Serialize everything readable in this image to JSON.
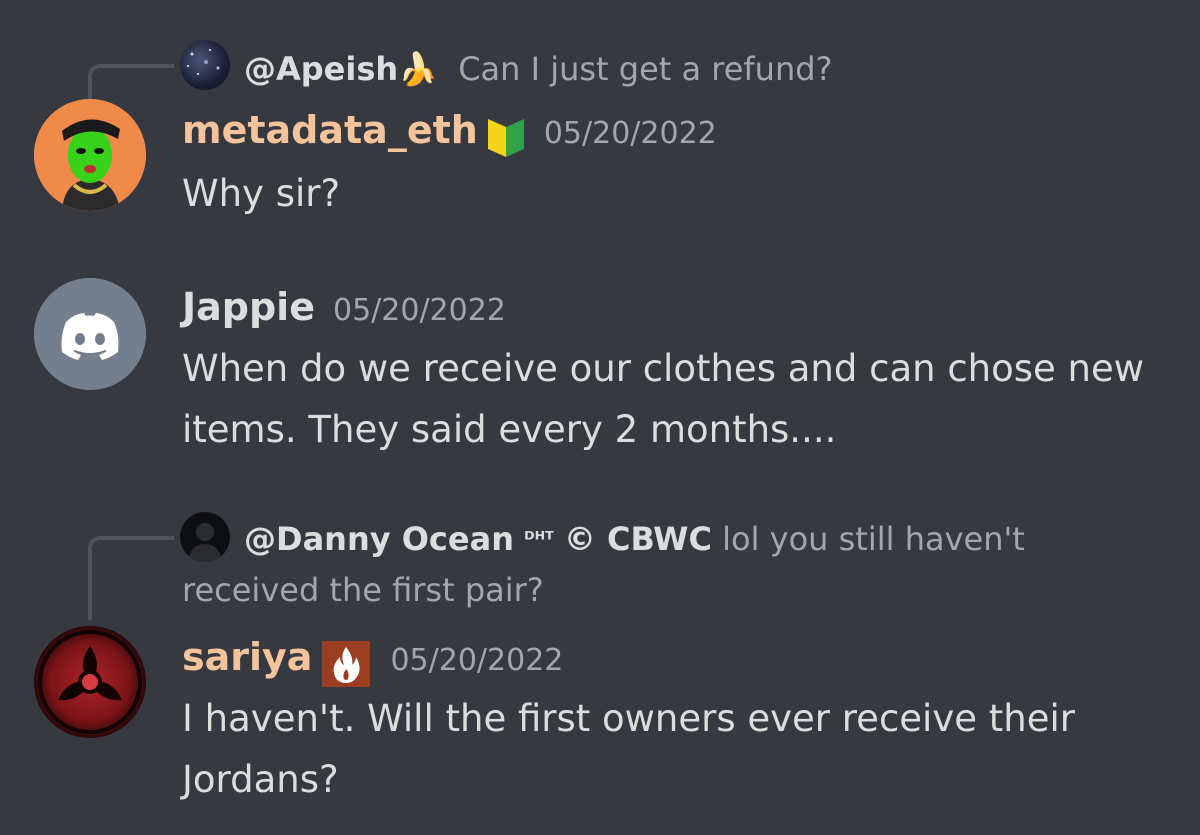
{
  "messages": [
    {
      "reply": {
        "name": "@Apeish",
        "emoji": "🍌",
        "text": "Can I just get a refund?"
      },
      "username": "metadata_eth",
      "username_color": "#f5c49b",
      "timestamp": "05/20/2022",
      "lines": [
        "Why sir?"
      ]
    },
    {
      "username": "Jappie",
      "username_color": "#dcddde",
      "timestamp": "05/20/2022",
      "lines": [
        "When do we receive our clothes and can chose new",
        "items. They said every 2 months...."
      ]
    },
    {
      "reply": {
        "name": "@Danny Ocean",
        "sup": "ᴰᴴᵀ",
        "suffix": "© CBWC",
        "text": "lol you still haven't",
        "text2": "received the first pair?"
      },
      "username": "sariya",
      "username_color": "#f5c49b",
      "timestamp": "05/20/2022",
      "lines": [
        "I haven't. Will the first owners ever receive their",
        "Jordans?"
      ]
    }
  ],
  "colors": {
    "background": "#36393f",
    "discord_blurple": "#5865f2",
    "default_avatar_bg": "#747f8d"
  }
}
